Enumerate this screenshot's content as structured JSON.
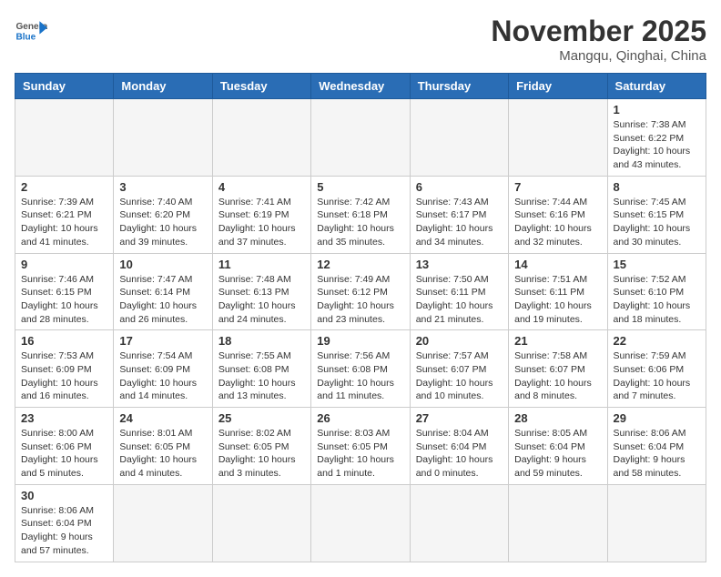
{
  "header": {
    "logo_general": "General",
    "logo_blue": "Blue",
    "month_title": "November 2025",
    "location": "Mangqu, Qinghai, China"
  },
  "days_of_week": [
    "Sunday",
    "Monday",
    "Tuesday",
    "Wednesday",
    "Thursday",
    "Friday",
    "Saturday"
  ],
  "weeks": [
    [
      {
        "day": "",
        "info": ""
      },
      {
        "day": "",
        "info": ""
      },
      {
        "day": "",
        "info": ""
      },
      {
        "day": "",
        "info": ""
      },
      {
        "day": "",
        "info": ""
      },
      {
        "day": "",
        "info": ""
      },
      {
        "day": "1",
        "info": "Sunrise: 7:38 AM\nSunset: 6:22 PM\nDaylight: 10 hours and 43 minutes."
      }
    ],
    [
      {
        "day": "2",
        "info": "Sunrise: 7:39 AM\nSunset: 6:21 PM\nDaylight: 10 hours and 41 minutes."
      },
      {
        "day": "3",
        "info": "Sunrise: 7:40 AM\nSunset: 6:20 PM\nDaylight: 10 hours and 39 minutes."
      },
      {
        "day": "4",
        "info": "Sunrise: 7:41 AM\nSunset: 6:19 PM\nDaylight: 10 hours and 37 minutes."
      },
      {
        "day": "5",
        "info": "Sunrise: 7:42 AM\nSunset: 6:18 PM\nDaylight: 10 hours and 35 minutes."
      },
      {
        "day": "6",
        "info": "Sunrise: 7:43 AM\nSunset: 6:17 PM\nDaylight: 10 hours and 34 minutes."
      },
      {
        "day": "7",
        "info": "Sunrise: 7:44 AM\nSunset: 6:16 PM\nDaylight: 10 hours and 32 minutes."
      },
      {
        "day": "8",
        "info": "Sunrise: 7:45 AM\nSunset: 6:15 PM\nDaylight: 10 hours and 30 minutes."
      }
    ],
    [
      {
        "day": "9",
        "info": "Sunrise: 7:46 AM\nSunset: 6:15 PM\nDaylight: 10 hours and 28 minutes."
      },
      {
        "day": "10",
        "info": "Sunrise: 7:47 AM\nSunset: 6:14 PM\nDaylight: 10 hours and 26 minutes."
      },
      {
        "day": "11",
        "info": "Sunrise: 7:48 AM\nSunset: 6:13 PM\nDaylight: 10 hours and 24 minutes."
      },
      {
        "day": "12",
        "info": "Sunrise: 7:49 AM\nSunset: 6:12 PM\nDaylight: 10 hours and 23 minutes."
      },
      {
        "day": "13",
        "info": "Sunrise: 7:50 AM\nSunset: 6:11 PM\nDaylight: 10 hours and 21 minutes."
      },
      {
        "day": "14",
        "info": "Sunrise: 7:51 AM\nSunset: 6:11 PM\nDaylight: 10 hours and 19 minutes."
      },
      {
        "day": "15",
        "info": "Sunrise: 7:52 AM\nSunset: 6:10 PM\nDaylight: 10 hours and 18 minutes."
      }
    ],
    [
      {
        "day": "16",
        "info": "Sunrise: 7:53 AM\nSunset: 6:09 PM\nDaylight: 10 hours and 16 minutes."
      },
      {
        "day": "17",
        "info": "Sunrise: 7:54 AM\nSunset: 6:09 PM\nDaylight: 10 hours and 14 minutes."
      },
      {
        "day": "18",
        "info": "Sunrise: 7:55 AM\nSunset: 6:08 PM\nDaylight: 10 hours and 13 minutes."
      },
      {
        "day": "19",
        "info": "Sunrise: 7:56 AM\nSunset: 6:08 PM\nDaylight: 10 hours and 11 minutes."
      },
      {
        "day": "20",
        "info": "Sunrise: 7:57 AM\nSunset: 6:07 PM\nDaylight: 10 hours and 10 minutes."
      },
      {
        "day": "21",
        "info": "Sunrise: 7:58 AM\nSunset: 6:07 PM\nDaylight: 10 hours and 8 minutes."
      },
      {
        "day": "22",
        "info": "Sunrise: 7:59 AM\nSunset: 6:06 PM\nDaylight: 10 hours and 7 minutes."
      }
    ],
    [
      {
        "day": "23",
        "info": "Sunrise: 8:00 AM\nSunset: 6:06 PM\nDaylight: 10 hours and 5 minutes."
      },
      {
        "day": "24",
        "info": "Sunrise: 8:01 AM\nSunset: 6:05 PM\nDaylight: 10 hours and 4 minutes."
      },
      {
        "day": "25",
        "info": "Sunrise: 8:02 AM\nSunset: 6:05 PM\nDaylight: 10 hours and 3 minutes."
      },
      {
        "day": "26",
        "info": "Sunrise: 8:03 AM\nSunset: 6:05 PM\nDaylight: 10 hours and 1 minute."
      },
      {
        "day": "27",
        "info": "Sunrise: 8:04 AM\nSunset: 6:04 PM\nDaylight: 10 hours and 0 minutes."
      },
      {
        "day": "28",
        "info": "Sunrise: 8:05 AM\nSunset: 6:04 PM\nDaylight: 9 hours and 59 minutes."
      },
      {
        "day": "29",
        "info": "Sunrise: 8:06 AM\nSunset: 6:04 PM\nDaylight: 9 hours and 58 minutes."
      }
    ],
    [
      {
        "day": "30",
        "info": "Sunrise: 8:06 AM\nSunset: 6:04 PM\nDaylight: 9 hours and 57 minutes."
      },
      {
        "day": "",
        "info": ""
      },
      {
        "day": "",
        "info": ""
      },
      {
        "day": "",
        "info": ""
      },
      {
        "day": "",
        "info": ""
      },
      {
        "day": "",
        "info": ""
      },
      {
        "day": "",
        "info": ""
      }
    ]
  ]
}
